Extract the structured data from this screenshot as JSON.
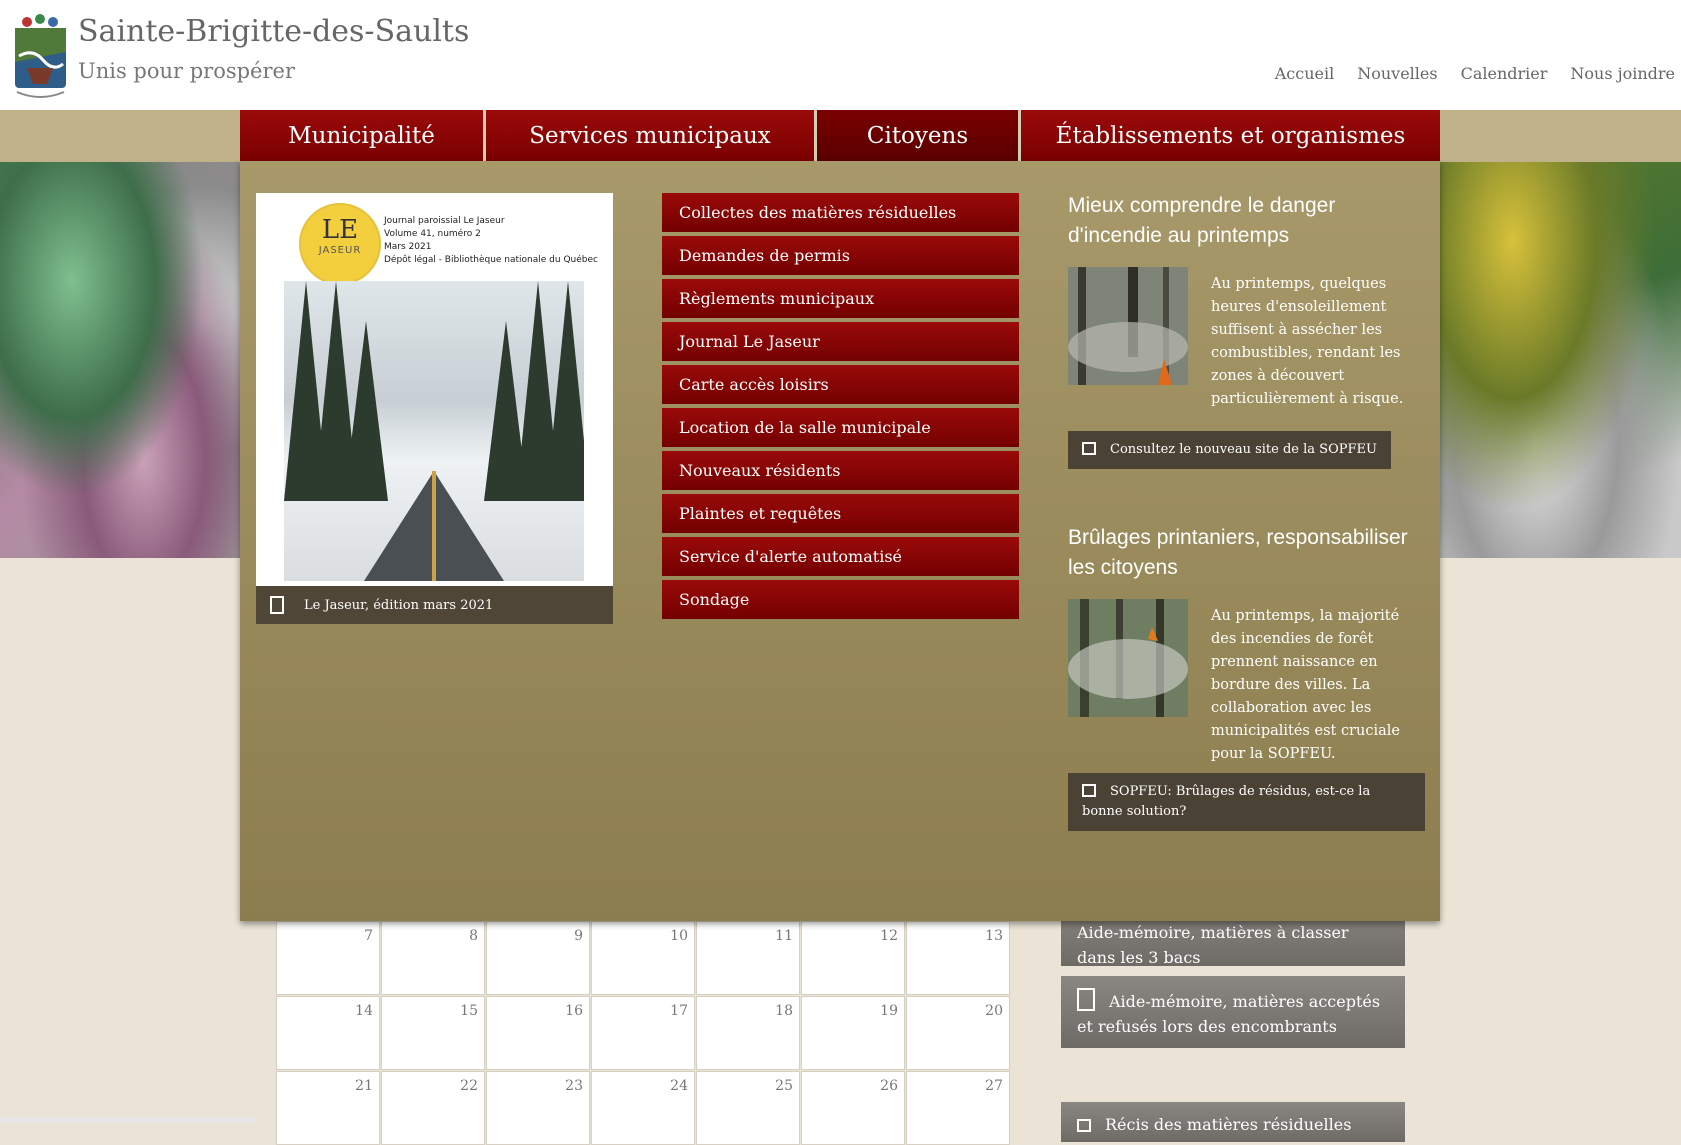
{
  "header": {
    "site_title": "Sainte-Brigitte-des-Saults",
    "tagline": "Unis pour prospérer",
    "top_links": [
      "Accueil",
      "Nouvelles",
      "Calendrier",
      "Nous joindre"
    ]
  },
  "nav": {
    "items": [
      {
        "label": "Municipalité"
      },
      {
        "label": "Services municipaux"
      },
      {
        "label": "Citoyens"
      },
      {
        "label": "Établissements et organismes"
      }
    ]
  },
  "mega": {
    "jaseur": {
      "logo_main": "LE",
      "logo_sub": "JASEUR",
      "meta": [
        "Journal paroissial Le Jaseur",
        "Volume 41, numéro 2",
        "Mars 2021",
        "Dépôt légal - Bibliothèque nationale du Québec"
      ],
      "caption": "Le Jaseur, édition mars 2021"
    },
    "links": [
      "Collectes des matières résiduelles",
      "Demandes de permis",
      "Règlements municipaux",
      "Journal Le Jaseur",
      "Carte accès loisirs",
      "Location de la salle municipale",
      "Nouveaux résidents",
      "Plaintes et requêtes",
      "Service d'alerte automatisé",
      "Sondage"
    ],
    "news": [
      {
        "title": "Mieux comprendre le danger d'incendie au printemps",
        "text": "Au printemps, quelques heures d'ensoleillement suffisent à assécher les combustibles, rendant les zones à découvert particulièrement à risque.",
        "button": "Consultez le nouveau site de la SOPFEU"
      },
      {
        "title": "Brûlages printaniers, responsabiliser les citoyens",
        "text": "Au printemps, la majorité des incendies de forêt prennent naissance en bordure des villes. La collaboration avec les municipalités est cruciale pour la SOPFEU.",
        "button": "SOPFEU: Brûlages de résidus, est-ce la bonne solution?"
      }
    ]
  },
  "calendar": {
    "weeks": [
      [
        "7",
        "8",
        "9",
        "10",
        "11",
        "12",
        "13"
      ],
      [
        "14",
        "15",
        "16",
        "17",
        "18",
        "19",
        "20"
      ],
      [
        "21",
        "22",
        "23",
        "24",
        "25",
        "26",
        "27"
      ]
    ]
  },
  "sidebar": {
    "buttons": [
      "Aide-mémoire, matières à classer dans les 3 bacs",
      "Aide-mémoire, matières acceptés et refusés lors des encombrants",
      "Récis des matières résiduelles"
    ]
  }
}
